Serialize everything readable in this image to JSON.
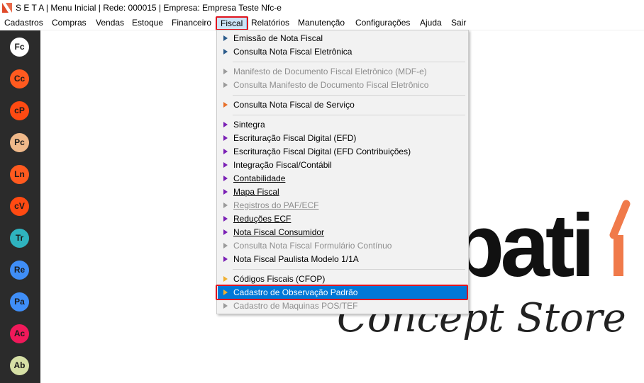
{
  "window": {
    "title": "S E T A | Menu Inicial | Rede: 000015 | Empresa: Empresa Teste Nfc-e"
  },
  "menubar": {
    "items": [
      {
        "label": "Cadastros"
      },
      {
        "label": "Compras"
      },
      {
        "label": "Vendas"
      },
      {
        "label": "Estoque"
      },
      {
        "label": "Financeiro"
      },
      {
        "label": "Fiscal",
        "active": true
      },
      {
        "label": "Relatórios"
      },
      {
        "label": "Manutenção"
      },
      {
        "label": "Configurações"
      },
      {
        "label": "Ajuda"
      },
      {
        "label": "Sair"
      }
    ]
  },
  "sidebar": {
    "buttons": [
      {
        "label": "Fc",
        "color": "#ffffff"
      },
      {
        "label": "Cc",
        "color": "#ff5a1f"
      },
      {
        "label": "cP",
        "color": "#ff4a12"
      },
      {
        "label": "Pc",
        "color": "#f0b98a"
      },
      {
        "label": "Ln",
        "color": "#ff5a1f"
      },
      {
        "label": "cV",
        "color": "#ff4a12"
      },
      {
        "label": "Tr",
        "color": "#2fb3bf"
      },
      {
        "label": "Re",
        "color": "#3f8ef7"
      },
      {
        "label": "Pa",
        "color": "#3f8ef7"
      },
      {
        "label": "Ac",
        "color": "#f0195a"
      },
      {
        "label": "Ab",
        "color": "#d6e0a6"
      }
    ]
  },
  "fiscal_menu": {
    "items": [
      {
        "label": "Emissão de Nota Fiscal",
        "enabled": true,
        "icon": "blue-arrow-icon"
      },
      {
        "label": "Consulta Nota Fiscal Eletrônica",
        "enabled": true,
        "icon": "blue-arrow-icon"
      },
      {
        "label": "Manifesto de Documento Fiscal Eletrônico (MDF-e)",
        "enabled": false,
        "icon": "gray-arrow-icon"
      },
      {
        "label": "Consulta Manifesto de Documento Fiscal Eletrônico",
        "enabled": false,
        "icon": "gray-arrow-icon"
      },
      {
        "label": "Consulta Nota Fiscal de Serviço",
        "enabled": true,
        "icon": "orange-arrow-icon"
      },
      {
        "label": "Sintegra",
        "enabled": true,
        "icon": "purple-arrow-icon"
      },
      {
        "label": "Escrituração Fiscal Digital (EFD)",
        "enabled": true,
        "icon": "purple-arrow-icon"
      },
      {
        "label": "Escrituração Fiscal Digital (EFD Contribuições)",
        "enabled": true,
        "icon": "purple-arrow-icon"
      },
      {
        "label": "Integração Fiscal/Contábil",
        "enabled": true,
        "icon": "purple-arrow-icon"
      },
      {
        "label": "Contabilidade",
        "enabled": true,
        "icon": "purple-arrow-icon"
      },
      {
        "label": "Mapa Fiscal",
        "enabled": true,
        "icon": "purple-arrow-icon"
      },
      {
        "label": "Registros do PAF/ECF",
        "enabled": false,
        "icon": "gray-arrow-icon"
      },
      {
        "label": "Reduções ECF",
        "enabled": true,
        "icon": "purple-arrow-icon"
      },
      {
        "label": "Nota Fiscal Consumidor",
        "enabled": true,
        "icon": "purple-arrow-icon"
      },
      {
        "label": "Consulta Nota Fiscal Formulário Contínuo",
        "enabled": false,
        "icon": "gray-arrow-icon"
      },
      {
        "label": "Nota Fiscal Paulista Modelo 1/1A",
        "enabled": true,
        "icon": "purple-arrow-icon"
      },
      {
        "label": "Códigos Fiscais (CFOP)",
        "enabled": true,
        "icon": "yellow-arrow-icon"
      },
      {
        "label": "Cadastro de Observação Padrão",
        "enabled": true,
        "selected": true,
        "icon": "yellow-arrow-icon"
      },
      {
        "label": "Cadastro de Maquinas POS/TEF",
        "enabled": false,
        "icon": "gray-arrow-icon"
      }
    ]
  },
  "background": {
    "brand_partial": "bati",
    "brand_tagline": "Concept Store"
  },
  "colors": {
    "accent_blue": "#0078d7",
    "highlight_red": "#e0141e",
    "brand_orange": "#f07a4a",
    "sidebar_bg": "#2b2b2b"
  }
}
